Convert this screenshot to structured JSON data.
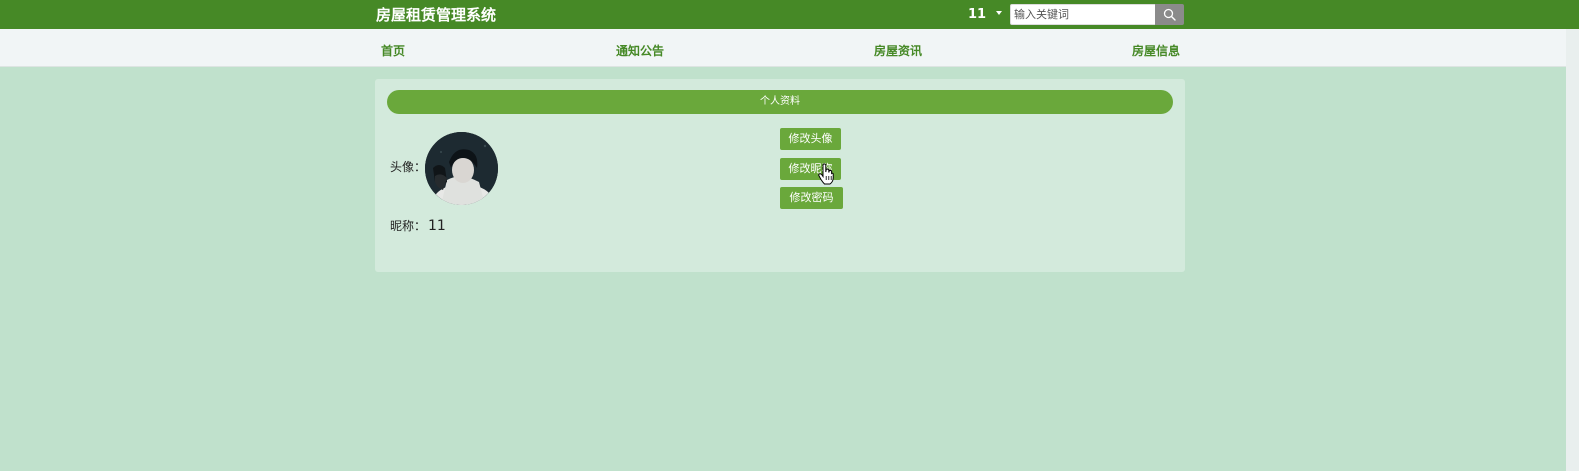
{
  "header": {
    "title": "房屋租赁管理系统",
    "user_name": "11",
    "search": {
      "placeholder": "输入关键词",
      "value": ""
    }
  },
  "nav": {
    "items": [
      {
        "label": "首页"
      },
      {
        "label": "通知公告"
      },
      {
        "label": "房屋资讯"
      },
      {
        "label": "房屋信息"
      }
    ]
  },
  "profile": {
    "section_title": "个人资料",
    "avatar_label": "头像：",
    "nickname_label": "昵称：",
    "nickname_value": "11",
    "buttons": {
      "change_avatar": "修改头像",
      "change_nickname": "修改昵称",
      "change_password": "修改密码"
    }
  },
  "theme": {
    "primary": "#468926",
    "accent": "#6aa83b",
    "background": "#c0e1cc",
    "panel": "#d3eadc"
  }
}
